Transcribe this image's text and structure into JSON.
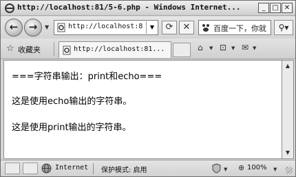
{
  "window": {
    "title": "http://localhost:81/5-6.php - Windows Internet..."
  },
  "navigation": {
    "address": "http://localhost:8",
    "search_text": "百度一下，你就",
    "icons": [
      "back-arrow-icon",
      "forward-arrow-icon",
      "refresh-icon",
      "stop-icon",
      "search-icon"
    ]
  },
  "favorites": {
    "label": "收藏夹"
  },
  "tab": {
    "title": "http://localhost:81..."
  },
  "content": {
    "lines": [
      "===字符串输出：print和echo===",
      "这是使用echo输出的字符串。",
      "这是使用print输出的字符串。"
    ]
  },
  "statusbar": {
    "zone": "Internet",
    "protected_mode": "保护模式: 启用",
    "zoom": "100%"
  }
}
